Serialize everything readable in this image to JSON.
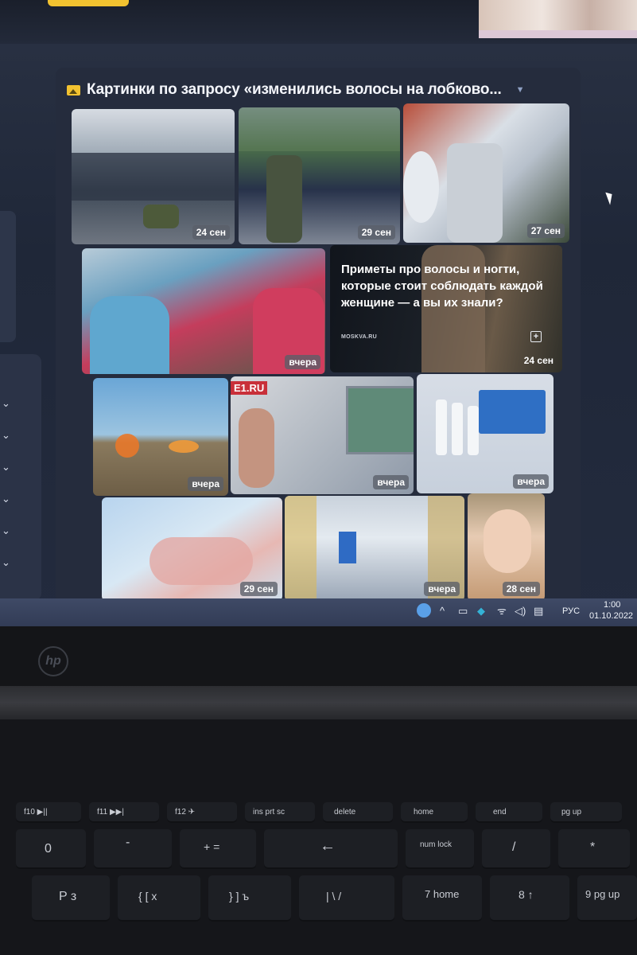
{
  "search_block": {
    "title": "Картинки по запросу «изменились волосы на лобково...",
    "icon": "image-icon",
    "accent_color": "#f2c230"
  },
  "tiles": [
    {
      "date": "24 сен"
    },
    {
      "date": "29 сен"
    },
    {
      "date": "27 сен"
    },
    {
      "date": "вчера"
    },
    {
      "date": "24 сен",
      "article_title": "Приметы про волосы и ногти, которые стоит соблюдать каждой женщине — а вы их знали?",
      "source": "MOSKVA.RU"
    },
    {
      "date": "вчера"
    },
    {
      "date": "вчера",
      "logo": "E1.RU"
    },
    {
      "date": "вчера"
    },
    {
      "date": "29 сен"
    },
    {
      "date": "вчера"
    },
    {
      "date": "28 сен"
    }
  ],
  "taskbar": {
    "language": "РУС",
    "time": "1:00",
    "date": "01.10.2022"
  },
  "keyboard": {
    "keys": [
      "f10 ▶||",
      "f11 ▶▶|",
      "f12 ✈",
      "ins prt sc",
      "delete",
      "home",
      "end",
      "pg up",
      "0",
      "-",
      "+ =",
      "←",
      "num lock",
      "/",
      "*",
      "P з",
      "{ [ х",
      "} ] ъ",
      "| \\ /",
      "7 home",
      "8 ↑",
      "9 pg up"
    ]
  }
}
